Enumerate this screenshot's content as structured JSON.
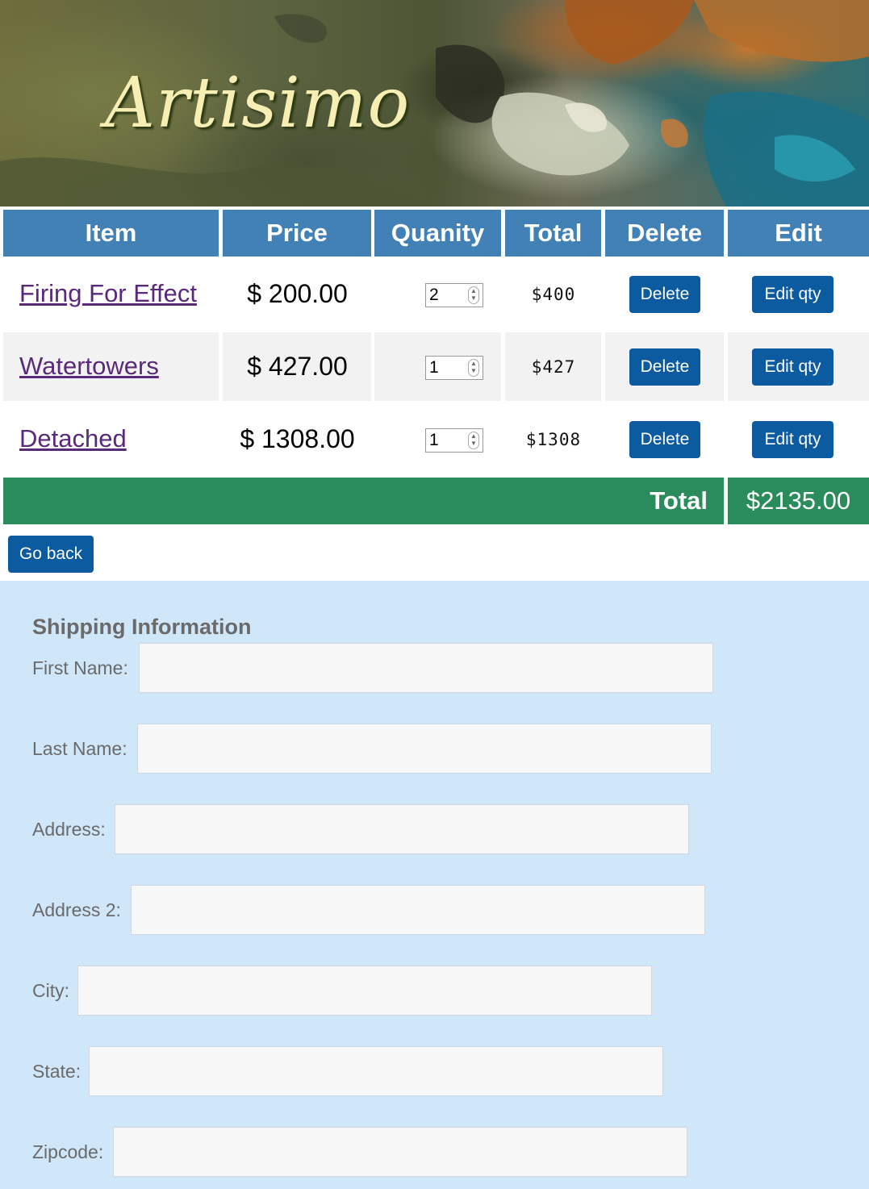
{
  "site": {
    "brand": "Artisimo"
  },
  "cart": {
    "headers": {
      "item": "Item",
      "price": "Price",
      "quantity": "Quanity",
      "total": "Total",
      "delete": "Delete",
      "edit": "Edit"
    },
    "rows": [
      {
        "item": "Firing For Effect",
        "price": "$ 200.00",
        "qty": "2",
        "total": "$400",
        "delete_label": "Delete",
        "edit_label": "Edit qty"
      },
      {
        "item": "Watertowers",
        "price": "$ 427.00",
        "qty": "1",
        "total": "$427",
        "delete_label": "Delete",
        "edit_label": "Edit qty"
      },
      {
        "item": "Detached",
        "price": "$ 1308.00",
        "qty": "1",
        "total": "$1308",
        "delete_label": "Delete",
        "edit_label": "Edit qty"
      }
    ],
    "grand_total_label": "Total",
    "grand_total_value": "$2135.00",
    "go_back_label": "Go back"
  },
  "shipping": {
    "title": "Shipping Information",
    "fields": [
      {
        "label": "First Name:",
        "value": ""
      },
      {
        "label": "Last Name:",
        "value": ""
      },
      {
        "label": "Address:",
        "value": ""
      },
      {
        "label": "Address 2:",
        "value": ""
      },
      {
        "label": "City:",
        "value": ""
      },
      {
        "label": "State:",
        "value": ""
      },
      {
        "label": "Zipcode:",
        "value": ""
      }
    ]
  },
  "colors": {
    "header_blue": "#4181b5",
    "button_blue": "#0c5ba0",
    "total_green": "#2a8c5a",
    "shipping_bg": "#d0e6f9",
    "link_purple": "#5a2a7a"
  }
}
